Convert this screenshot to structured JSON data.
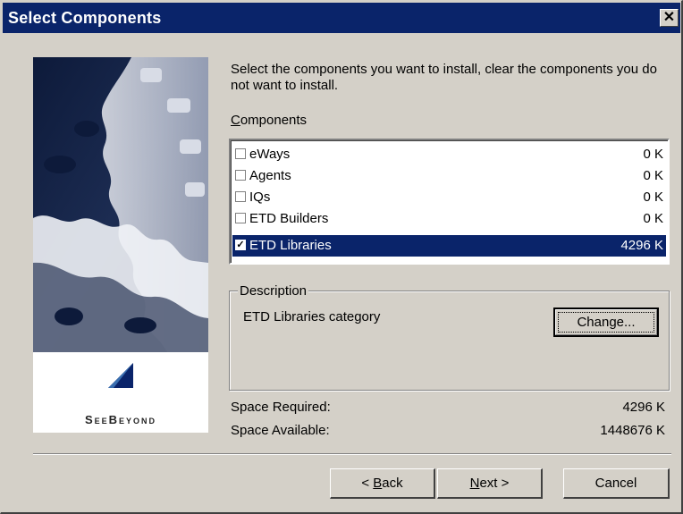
{
  "window": {
    "title": "Select Components",
    "close_glyph": "✕"
  },
  "instruction": "Select the components you want to install, clear the components you do not want to install.",
  "components": {
    "label_accel": "C",
    "label_rest": "omponents",
    "items": [
      {
        "name": "eWays",
        "size": "0 K",
        "checked": false,
        "selected": false
      },
      {
        "name": "Agents",
        "size": "0 K",
        "checked": false,
        "selected": false
      },
      {
        "name": "IQs",
        "size": "0 K",
        "checked": false,
        "selected": false
      },
      {
        "name": "ETD Builders",
        "size": "0 K",
        "checked": false,
        "selected": false
      },
      {
        "name": "ETD Libraries",
        "size": "4296 K",
        "checked": true,
        "selected": true
      }
    ]
  },
  "description": {
    "group_label": "Description",
    "text": "ETD Libraries category",
    "change_button": "Change..."
  },
  "space": {
    "required_label": "Space Required:",
    "required_value": "4296 K",
    "available_label": "Space Available:",
    "available_value": "1448676 K"
  },
  "buttons": {
    "back_prefix": "< ",
    "back_accel": "B",
    "back_rest": "ack",
    "next_accel": "N",
    "next_rest": "ext >",
    "cancel": "Cancel"
  },
  "branding": {
    "logo_text": "SeeBeyond",
    "logo_icon": "seebeyond-logo-icon"
  },
  "colors": {
    "title_bar": "#0a246a",
    "selection": "#0a246a",
    "dialog_face": "#d4d0c8"
  }
}
